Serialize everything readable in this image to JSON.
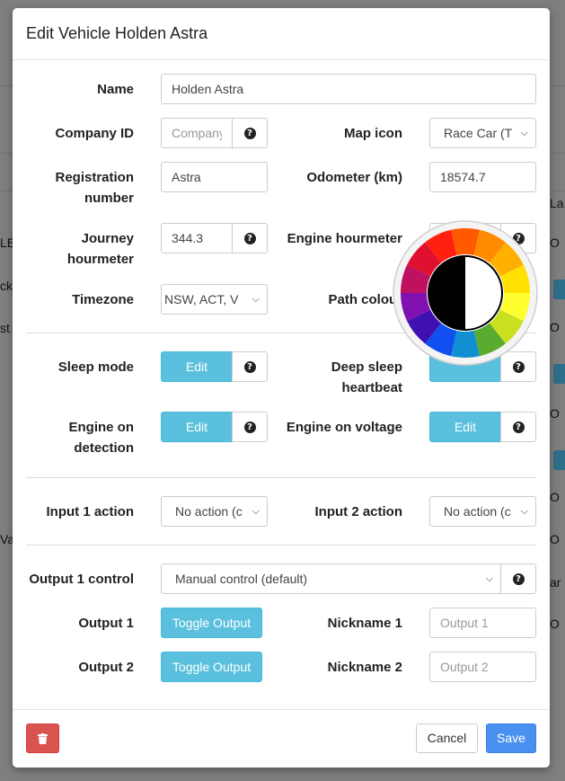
{
  "background": {
    "right_cells": [
      "La",
      "O",
      "",
      "O",
      "",
      "O",
      "",
      "O",
      "",
      "O",
      "ar",
      "O"
    ],
    "left_cells": [
      "LE",
      "ck",
      "st",
      "Va"
    ]
  },
  "modal": {
    "title": "Edit Vehicle Holden Astra",
    "fields": {
      "name": {
        "label": "Name",
        "value": "Holden Astra"
      },
      "company_id": {
        "label": "Company ID",
        "placeholder": "Company"
      },
      "map_icon": {
        "label": "Map icon",
        "value": "Race Car (T"
      },
      "registration": {
        "label": "Registration number",
        "value": "Astra"
      },
      "odometer": {
        "label": "Odometer (km)",
        "value": "18574.7"
      },
      "journey_hourmeter": {
        "label": "Journey hourmeter",
        "value": "344.3"
      },
      "engine_hourmeter": {
        "label": "Engine hourmeter"
      },
      "timezone": {
        "label": "Timezone",
        "value": "NSW, ACT, V"
      },
      "path_colour": {
        "label": "Path colour"
      },
      "sleep_mode": {
        "label": "Sleep mode",
        "button": "Edit"
      },
      "deep_sleep": {
        "label": "Deep sleep heartbeat"
      },
      "engine_on_detection": {
        "label": "Engine on detection",
        "button": "Edit"
      },
      "engine_on_voltage": {
        "label": "Engine on voltage",
        "button": "Edit"
      },
      "input1": {
        "label": "Input 1 action",
        "value": "No action (c"
      },
      "input2": {
        "label": "Input 2 action",
        "value": "No action (c"
      },
      "output1_control": {
        "label": "Output 1 control",
        "value": "Manual control (default)"
      },
      "output1": {
        "label": "Output 1",
        "button": "Toggle Output"
      },
      "output2": {
        "label": "Output 2",
        "button": "Toggle Output"
      },
      "nickname1": {
        "label": "Nickname 1",
        "placeholder": "Output 1"
      },
      "nickname2": {
        "label": "Nickname 2",
        "placeholder": "Output 2"
      }
    },
    "help_icon": "question-circle-icon",
    "footer": {
      "cancel": "Cancel",
      "save": "Save",
      "delete_icon": "trash-icon"
    }
  },
  "colors": {
    "info": "#5bc0de",
    "primary": "#4a90f0",
    "danger": "#d9534f",
    "wheel": [
      "#ff5a00",
      "#ff8c00",
      "#ffb000",
      "#ffe000",
      "#ffff30",
      "#c8e020",
      "#5aac30",
      "#1090d0",
      "#1050f0",
      "#4010b0",
      "#8010b0",
      "#c01060",
      "#e01030",
      "#ff2010"
    ]
  }
}
